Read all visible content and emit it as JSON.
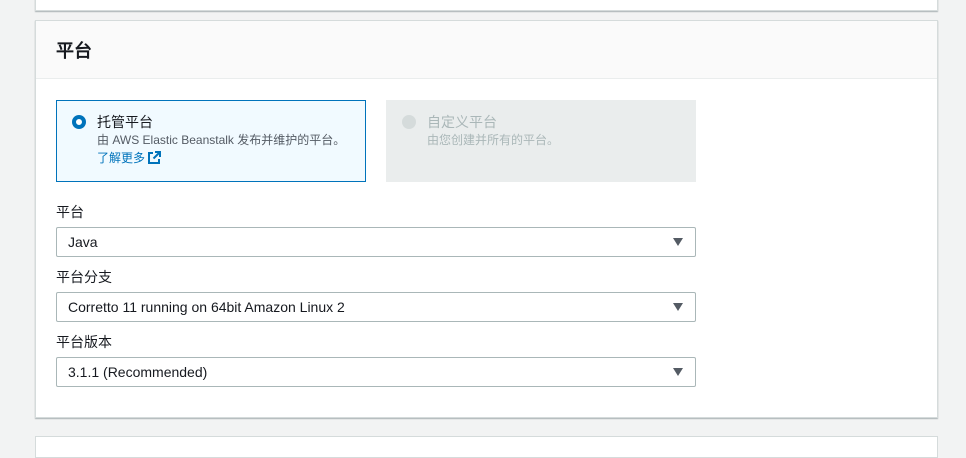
{
  "panel": {
    "title": "平台"
  },
  "tiles": [
    {
      "title": "托管平台",
      "description": "由 AWS Elastic Beanstalk 发布并维护的平台。",
      "link": "了解更多",
      "selected": true
    },
    {
      "title": "自定义平台",
      "description": "由您创建并所有的平台。",
      "selected": false,
      "disabled": true
    }
  ],
  "fields": {
    "platform": {
      "label": "平台",
      "value": "Java"
    },
    "branch": {
      "label": "平台分支",
      "value": "Corretto 11 running on 64bit Amazon Linux 2"
    },
    "version": {
      "label": "平台版本",
      "value": "3.1.1 (Recommended)"
    }
  },
  "icons": {
    "external_link": "external-link-icon",
    "caret": "caret-down-icon"
  },
  "colors": {
    "accent": "#0073bb",
    "selected_bg": "#f1faff",
    "disabled_bg": "#eaeded"
  }
}
